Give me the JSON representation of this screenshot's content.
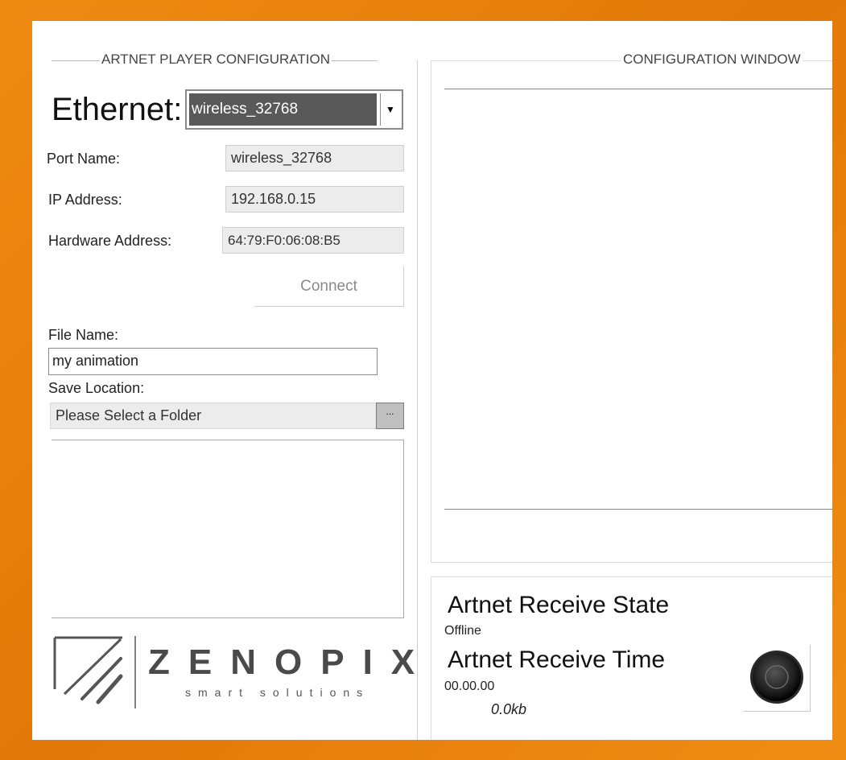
{
  "left_panel": {
    "legend": "ARTNET PLAYER CONFIGURATION",
    "ethernet_label": "Ethernet:",
    "ethernet_selected": "wireless_32768",
    "port_name_label": "Port Name:",
    "port_name_value": "wireless_32768",
    "ip_address_label": "IP Address:",
    "ip_address_value": "192.168.0.15",
    "hardware_address_label": "Hardware Address:",
    "hardware_address_value": "64:79:F0:06:08:B5",
    "connect_label": "Connect",
    "file_name_label": "File Name:",
    "file_name_value": "my animation",
    "save_location_label": "Save Location:",
    "save_location_value": "Please Select a Folder",
    "browse_label": "...",
    "logo_name": "ZENOPIX",
    "logo_tagline": "smart solutions"
  },
  "right_panel": {
    "legend": "CONFIGURATION WINDOW"
  },
  "status": {
    "receive_state_title": "Artnet Receive State",
    "receive_state_value": "Offline",
    "receive_time_title": "Artnet Receive Time",
    "receive_time_value": "00.00.00",
    "data_size": "0.0kb"
  },
  "colors": {
    "border_orange": "#e8820c",
    "combo_bg": "#595959"
  }
}
